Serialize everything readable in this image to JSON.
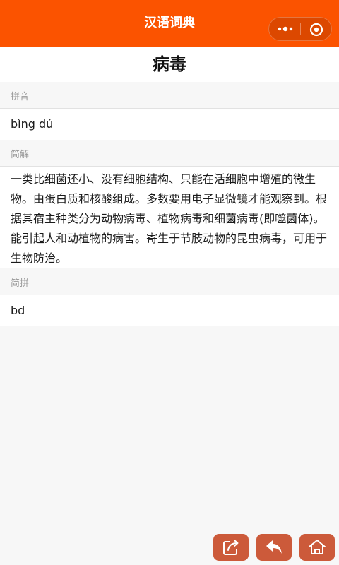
{
  "app": {
    "title": "汉语词典"
  },
  "capsule": {
    "more_icon": "more-dots-icon",
    "close_icon": "target-icon"
  },
  "word": {
    "title": "病毒"
  },
  "sections": {
    "pinyin": {
      "label": "拼音",
      "value": "bìng dú"
    },
    "explanation": {
      "label": "简解",
      "value": "一类比细菌还小、没有细胞结构、只能在活细胞中增殖的微生物。由蛋白质和核酸组成。多数要用电子显微镜才能观察到。根据其宿主种类分为动物病毒、植物病毒和细菌病毒(即噬菌体)。能引起人和动植物的病害。寄生于节肢动物的昆虫病毒，可用于生物防治。"
    },
    "abbr": {
      "label": "简拼",
      "value": "bd"
    }
  },
  "actions": {
    "share_icon": "share-icon",
    "back_icon": "back-arrow-icon",
    "home_icon": "home-icon"
  },
  "colors": {
    "nav_bg": "#fb5300",
    "fab_bg": "#cc5a3a",
    "page_bg": "#f7f7f7"
  }
}
